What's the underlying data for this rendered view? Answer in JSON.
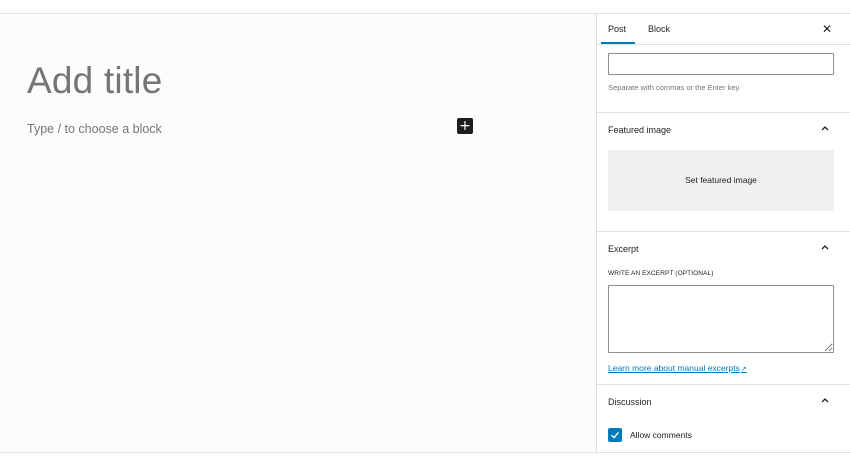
{
  "editor": {
    "title_placeholder": "Add title",
    "block_placeholder": "Type / to choose a block",
    "inserter_symbol": "+"
  },
  "sidebar": {
    "tabs": [
      {
        "label": "Post",
        "active": true
      },
      {
        "label": "Block",
        "active": false
      }
    ],
    "close_symbol": "✕",
    "tags": {
      "value": "",
      "help": "Separate with commas or the Enter key."
    },
    "featured_image": {
      "title": "Featured image",
      "button_label": "Set featured image",
      "expanded": true
    },
    "excerpt": {
      "title": "Excerpt",
      "label": "WRITE AN EXCERPT (OPTIONAL)",
      "value": "",
      "learn_more": "Learn more about manual excerpts",
      "expanded": true
    },
    "discussion": {
      "title": "Discussion",
      "allow_comments_label": "Allow comments",
      "allow_comments_checked": true,
      "expanded": true
    }
  },
  "colors": {
    "accent": "#007cba",
    "text": "#1e1e1e",
    "muted": "#757575",
    "border": "#e0e0e0"
  },
  "icons": {
    "inserter": "plus-icon",
    "close": "close-icon",
    "panel_toggle": "chevron-up-icon",
    "external": "external-link-icon",
    "check": "checkmark-icon"
  }
}
